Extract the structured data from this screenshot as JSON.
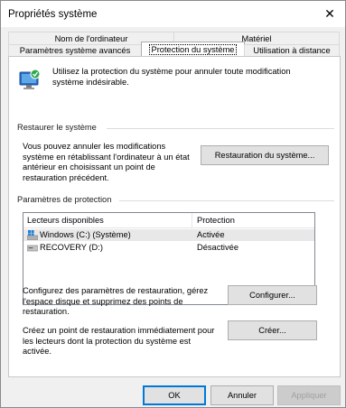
{
  "window": {
    "title": "Propriétés système",
    "close_glyph": "✕"
  },
  "tabs": {
    "row1": [
      "Nom de l'ordinateur",
      "Matériel"
    ],
    "row2": [
      "Paramètres système avancés",
      "Protection du système",
      "Utilisation à distance"
    ]
  },
  "intro": {
    "icon": "system-protection-icon",
    "text_line1": "Utilisez la protection du système pour annuler toute modification",
    "text_line2": "système indésirable."
  },
  "restore": {
    "section_title": "Restaurer le système",
    "description_lines": [
      "Vous pouvez annuler les modifications",
      "système en rétablissant l'ordinateur à un état",
      "antérieur en choisissant un point de",
      "restauration précédent."
    ],
    "button_label": "Restauration du système..."
  },
  "protection": {
    "section_title": "Paramètres de protection",
    "columns": [
      "Lecteurs disponibles",
      "Protection"
    ],
    "drives": [
      {
        "name": "Windows (C:) (Système)",
        "protection": "Activée",
        "icon": "windows-drive-icon"
      },
      {
        "name": "RECOVERY (D:)",
        "protection": "Désactivée",
        "icon": "drive-icon"
      }
    ]
  },
  "configure": {
    "description_lines": [
      "Configurez des paramètres de restauration, gérez",
      "l'espace disque et supprimez des points de",
      "restauration."
    ],
    "button_label": "Configurer..."
  },
  "create": {
    "description_lines": [
      "Créez un point de restauration immédiatement pour",
      "les lecteurs dont la protection du système est",
      "activée."
    ],
    "button_label": "Créer..."
  },
  "footer": {
    "ok": "OK",
    "cancel": "Annuler",
    "apply": "Appliquer"
  }
}
